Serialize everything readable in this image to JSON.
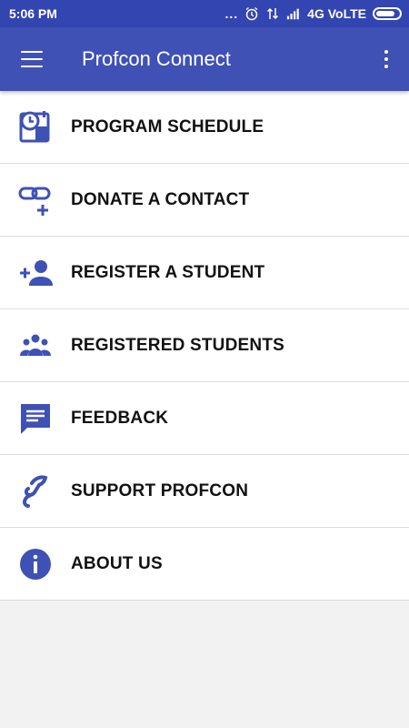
{
  "status_bar": {
    "time": "5:06 PM",
    "dots": "...",
    "network": "4G VoLTE",
    "icons": [
      "alarm-icon",
      "data-transfer-icon",
      "signal-icon",
      "battery-icon"
    ]
  },
  "app_bar": {
    "title": "Profcon Connect",
    "menu_icon": "hamburger-menu-icon",
    "overflow_icon": "overflow-menu-icon",
    "color": "#3f51b5"
  },
  "menu": {
    "icon_color": "#3f51b5",
    "items": [
      {
        "label": "PROGRAM SCHEDULE",
        "icon": "schedule-icon"
      },
      {
        "label": "DONATE A CONTACT",
        "icon": "link-add-icon"
      },
      {
        "label": "REGISTER A STUDENT",
        "icon": "person-add-icon"
      },
      {
        "label": "REGISTERED STUDENTS",
        "icon": "group-icon"
      },
      {
        "label": "FEEDBACK",
        "icon": "feedback-icon"
      },
      {
        "label": "SUPPORT PROFCON",
        "icon": "support-hand-icon"
      },
      {
        "label": "ABOUT US",
        "icon": "info-icon"
      }
    ]
  }
}
